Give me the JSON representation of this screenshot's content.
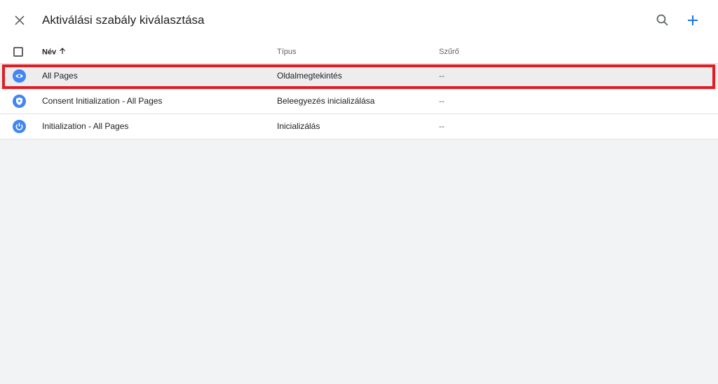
{
  "header": {
    "title": "Aktiválási szabály kiválasztása",
    "close_icon": "close-icon",
    "search_icon": "search-icon",
    "add_icon": "add-icon"
  },
  "table": {
    "columns": {
      "name": "Név",
      "type": "Típus",
      "filter": "Szűrő"
    },
    "sort": {
      "column": "name",
      "direction": "ascending"
    },
    "rows": [
      {
        "icon": "eye-icon",
        "name": "All Pages",
        "type": "Oldalmegtekintés",
        "filter": "--",
        "selected": true
      },
      {
        "icon": "shield-icon",
        "name": "Consent Initialization - All Pages",
        "type": "Beleegyezés inicializálása",
        "filter": "--",
        "selected": false
      },
      {
        "icon": "power-icon",
        "name": "Initialization - All Pages",
        "type": "Inicializálás",
        "filter": "--",
        "selected": false
      }
    ]
  },
  "colors": {
    "accent": "#1a73e8",
    "icon_bg": "#4285f4",
    "highlight": "#e31b23",
    "page_bg": "#f1f3f4"
  }
}
